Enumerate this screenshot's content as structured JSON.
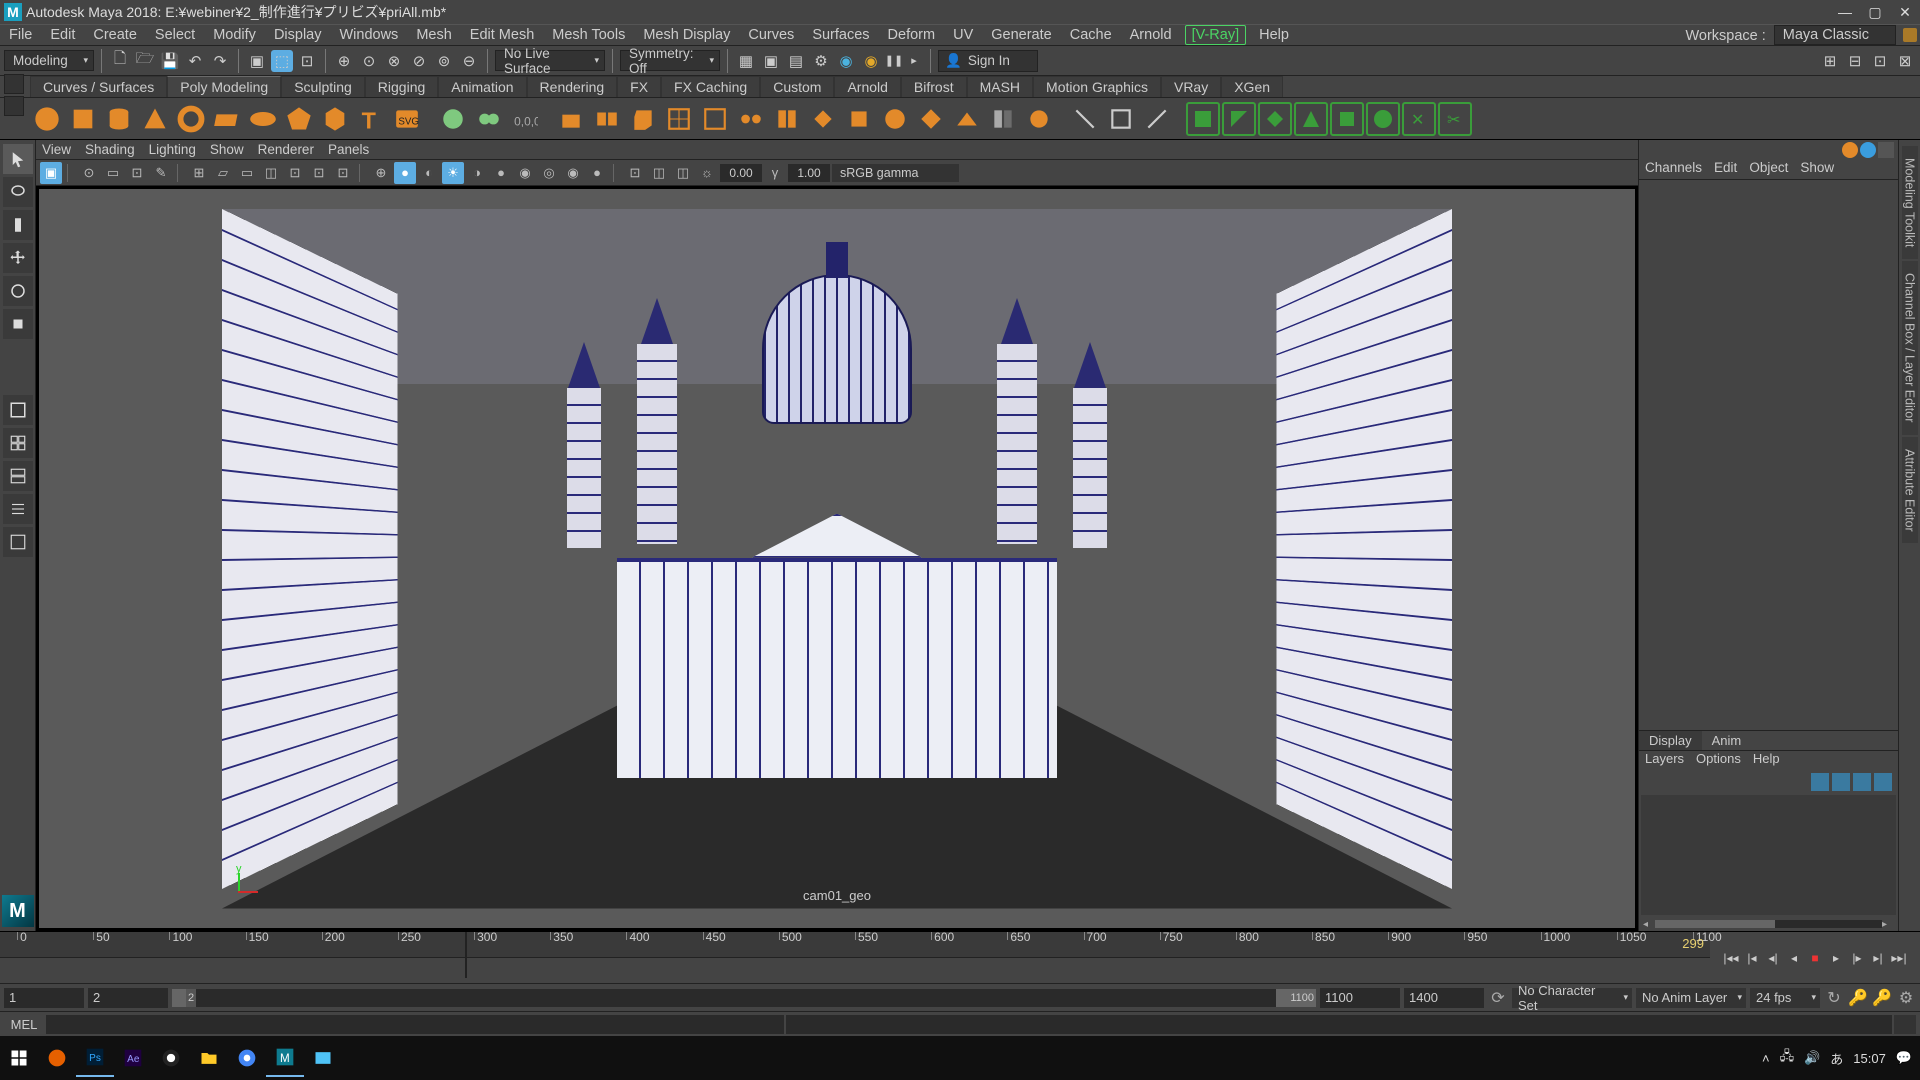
{
  "title": "Autodesk Maya 2018: E:¥webiner¥2_制作進行¥プリビズ¥priAll.mb*",
  "menus": [
    "File",
    "Edit",
    "Create",
    "Select",
    "Modify",
    "Display",
    "Windows",
    "Mesh",
    "Edit Mesh",
    "Mesh Tools",
    "Mesh Display",
    "Curves",
    "Surfaces",
    "Deform",
    "UV",
    "Generate",
    "Cache",
    "Arnold"
  ],
  "menu_vray": "[V-Ray]",
  "menu_help": "Help",
  "workspace_label": "Workspace :",
  "workspace_value": "Maya Classic",
  "moduleset": "Modeling",
  "live_surface": "No Live Surface",
  "symmetry": "Symmetry: Off",
  "signin": "Sign In",
  "shelf_tabs": [
    "Curves / Surfaces",
    "Poly Modeling",
    "Sculpting",
    "Rigging",
    "Animation",
    "Rendering",
    "FX",
    "FX Caching",
    "Custom",
    "Arnold",
    "Bifrost",
    "MASH",
    "Motion Graphics",
    "VRay",
    "XGen"
  ],
  "shelf_active": 1,
  "vp_menus": [
    "View",
    "Shading",
    "Lighting",
    "Show",
    "Renderer",
    "Panels"
  ],
  "vp_num_a": "0.00",
  "vp_num_b": "1.00",
  "vp_gamma": "sRGB gamma",
  "cam_name": "cam01_geo",
  "axis_label": "y",
  "chan_tabs": [
    "Channels",
    "Edit",
    "Object",
    "Show"
  ],
  "disp_tabs": [
    "Display",
    "Anim"
  ],
  "layer_tabs": [
    "Layers",
    "Options",
    "Help"
  ],
  "right_tabs": [
    "Modeling Toolkit",
    "Channel Box / Layer Editor",
    "Attribute Editor"
  ],
  "timeline_ticks": [
    "0",
    "50",
    "100",
    "150",
    "200",
    "250",
    "300",
    "350",
    "400",
    "450",
    "500",
    "550",
    "600",
    "650",
    "700",
    "750",
    "800",
    "850",
    "900",
    "950",
    "1000",
    "1050",
    "1100"
  ],
  "timeline_cur": "299",
  "timeline_head_pos": 27.2,
  "range_start": "1",
  "range_in": "2",
  "range_in_h": "2",
  "range_out": "1100",
  "range_end": "1100",
  "range_total": "1400",
  "charset": "No Character Set",
  "animlayer": "No Anim Layer",
  "fps": "24 fps",
  "cmd_label": "MEL",
  "tray_jp": "あ",
  "tray_time": "15:07",
  "iconmap": {
    "new": "🗋",
    "open": "📁",
    "save": "💾",
    "undo": "↶",
    "redo": "↷"
  }
}
